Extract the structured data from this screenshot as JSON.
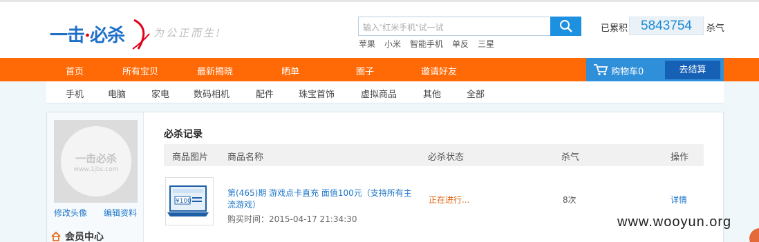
{
  "brand": {
    "logo_left": "一击",
    "logo_mid": "必",
    "logo_right": "杀",
    "slogan": "为公正而生!"
  },
  "search": {
    "placeholder": "输入\"红米手机\"试一试",
    "hot_words": [
      "苹果",
      "小米",
      "智能手机",
      "单反",
      "三星"
    ]
  },
  "stats": {
    "prefix": "已累积",
    "count": "5843754",
    "suffix": "杀气"
  },
  "nav": {
    "items": [
      "首页",
      "所有宝贝",
      "最新揭晓",
      "晒单",
      "圈子",
      "邀请好友"
    ],
    "cart_label": "购物车0",
    "checkout_label": "去结算"
  },
  "categories": [
    "手机",
    "电脑",
    "家电",
    "数码相机",
    "配件",
    "珠宝首饰",
    "虚拟商品",
    "其他",
    "全部"
  ],
  "sidebar": {
    "avatar_name": "一击必杀",
    "avatar_url": "www.1jbs.com",
    "edit_avatar": "修改头像",
    "edit_profile": "编辑资料",
    "member_center": "会员中心"
  },
  "records": {
    "title": "必杀记录",
    "columns": [
      "商品图片",
      "商品名称",
      "必杀状态",
      "杀气",
      "操作"
    ],
    "rows": [
      {
        "name": "第(465)期 游戏点卡直充 面值100元（支持所有主流游戏）",
        "time": "购买时间：2015-04-17 21:34:30",
        "status": "正在进行...",
        "qty": "8次",
        "action": "详情",
        "card_value": "¥100"
      }
    ]
  },
  "watermark": "www.wooyun.org",
  "colors": {
    "nav_orange": "#ff6a06",
    "accent_blue": "#1e90e0",
    "status_orange": "#e2630d"
  }
}
